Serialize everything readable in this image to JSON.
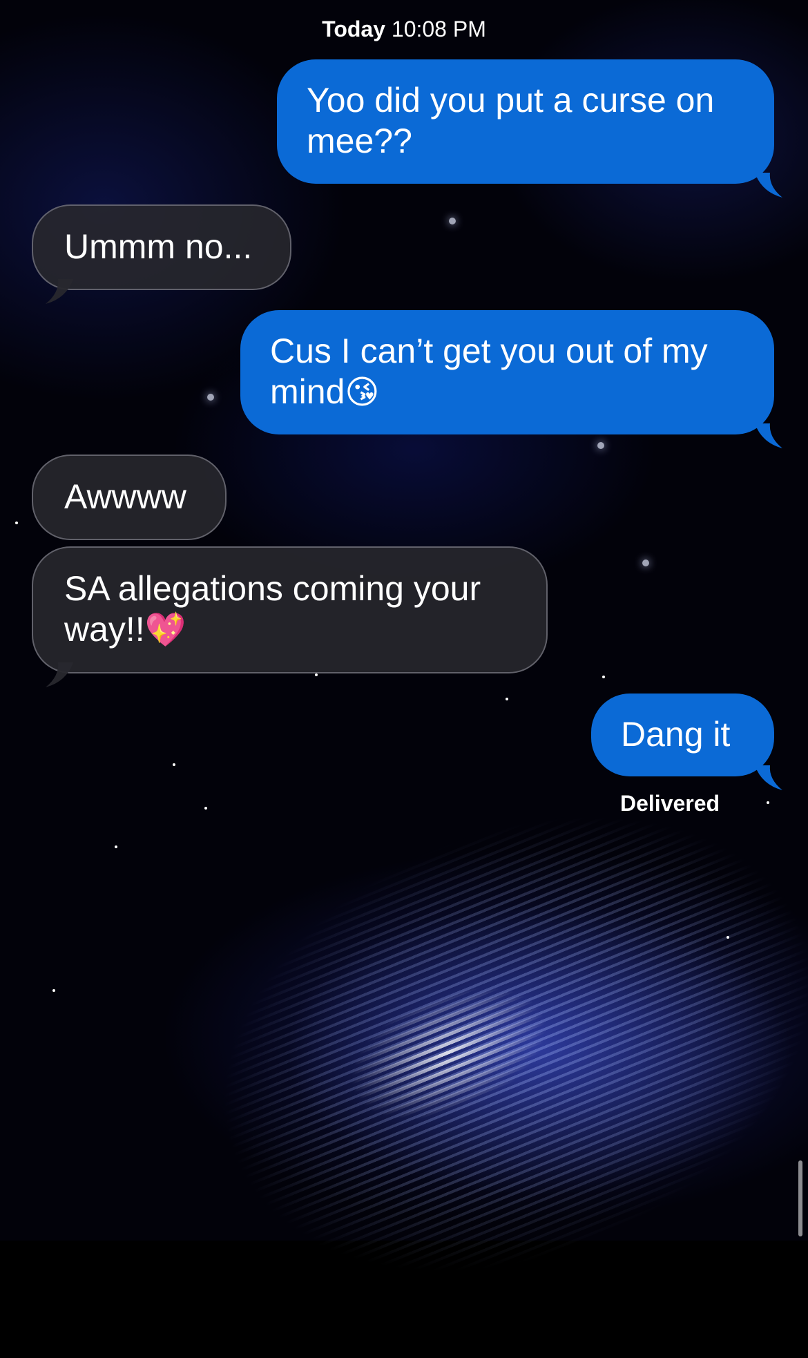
{
  "thread": {
    "timestamp_day": "Today",
    "timestamp_time": "10:08 PM",
    "delivery_status": "Delivered"
  },
  "messages": [
    {
      "direction": "sent",
      "text": "Yoo did you put a curse on mee??"
    },
    {
      "direction": "received",
      "text": "Ummm no..."
    },
    {
      "direction": "sent",
      "text": "Cus I can’t get you out of my mind",
      "emoji": "😘"
    },
    {
      "direction": "received",
      "text": "Awwww"
    },
    {
      "direction": "received",
      "text": "SA allegations coming your way!!",
      "emoji": "💖"
    },
    {
      "direction": "sent",
      "text": "Dang it"
    }
  ],
  "colors": {
    "sent_bubble": "#0b6ad6",
    "received_bubble": "#28282e",
    "background": "#02020a"
  },
  "icons": {
    "background": "galaxy-wallpaper"
  }
}
